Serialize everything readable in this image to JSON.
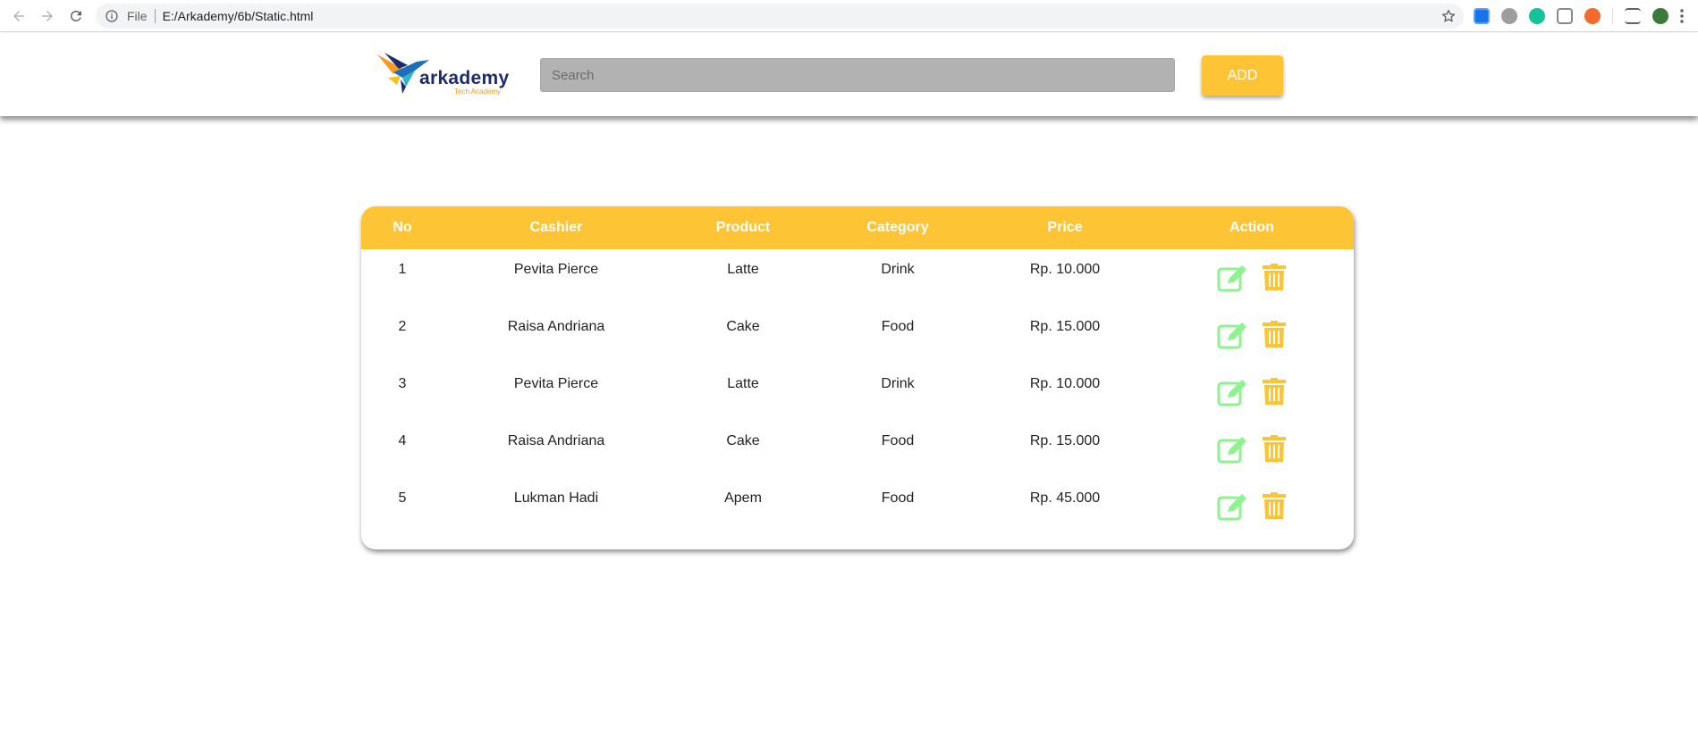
{
  "browser": {
    "file_label": "File",
    "url": "E:/Arkademy/6b/Static.html"
  },
  "header": {
    "logo_text": "arkademy",
    "logo_subtext": "Tech Academy",
    "search_placeholder": "Search",
    "add_label": "ADD"
  },
  "colors": {
    "accent": "#fdc536",
    "edit": "#8ef28e",
    "delete": "#fdc536"
  },
  "table": {
    "columns": [
      "No",
      "Cashier",
      "Product",
      "Category",
      "Price",
      "Action"
    ],
    "rows": [
      {
        "no": "1",
        "cashier": "Pevita Pierce",
        "product": "Latte",
        "category": "Drink",
        "price": "Rp. 10.000"
      },
      {
        "no": "2",
        "cashier": "Raisa Andriana",
        "product": "Cake",
        "category": "Food",
        "price": "Rp. 15.000"
      },
      {
        "no": "3",
        "cashier": "Pevita Pierce",
        "product": "Latte",
        "category": "Drink",
        "price": "Rp. 10.000"
      },
      {
        "no": "4",
        "cashier": "Raisa Andriana",
        "product": "Cake",
        "category": "Food",
        "price": "Rp. 15.000"
      },
      {
        "no": "5",
        "cashier": "Lukman Hadi",
        "product": "Apem",
        "category": "Food",
        "price": "Rp. 45.000"
      }
    ],
    "row_icons": {
      "edit": "edit-icon",
      "delete": "trash-icon"
    }
  }
}
